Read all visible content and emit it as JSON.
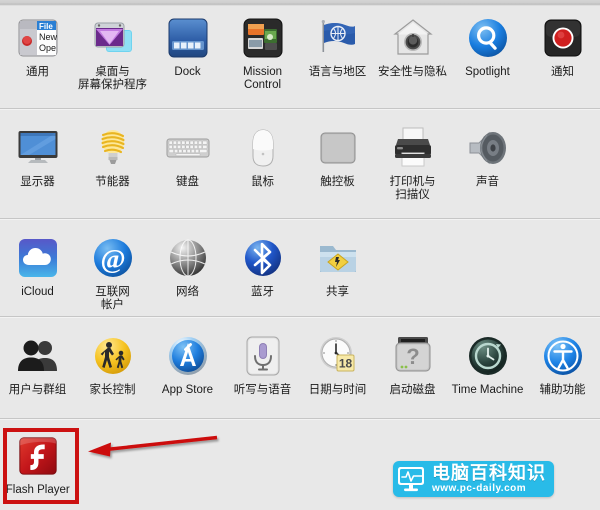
{
  "window": {
    "title": "System Preferences",
    "background_color": "#e8e8e8",
    "accent_color": "#cc1111"
  },
  "groups": [
    {
      "name": "personal",
      "items": [
        {
          "label": "通用",
          "icon": "general-icon"
        },
        {
          "label": "桌面与\n屏幕保护程序",
          "icon": "desktop-screensaver-icon"
        },
        {
          "label": "Dock",
          "icon": "dock-icon"
        },
        {
          "label": "Mission\nControl",
          "icon": "mission-control-icon"
        },
        {
          "label": "语言与地区",
          "icon": "language-region-icon"
        },
        {
          "label": "安全性与隐私",
          "icon": "security-privacy-icon"
        },
        {
          "label": "Spotlight",
          "icon": "spotlight-icon"
        },
        {
          "label": "通知",
          "icon": "notifications-icon"
        }
      ]
    },
    {
      "name": "hardware",
      "items": [
        {
          "label": "显示器",
          "icon": "displays-icon"
        },
        {
          "label": "节能器",
          "icon": "energy-saver-icon"
        },
        {
          "label": "键盘",
          "icon": "keyboard-icon"
        },
        {
          "label": "鼠标",
          "icon": "mouse-icon"
        },
        {
          "label": "触控板",
          "icon": "trackpad-icon"
        },
        {
          "label": "打印机与\n扫描仪",
          "icon": "printers-scanners-icon"
        },
        {
          "label": "声音",
          "icon": "sound-icon"
        }
      ]
    },
    {
      "name": "internet-wireless",
      "items": [
        {
          "label": "iCloud",
          "icon": "icloud-icon"
        },
        {
          "label": "互联网\n帐户",
          "icon": "internet-accounts-icon"
        },
        {
          "label": "网络",
          "icon": "network-icon"
        },
        {
          "label": "蓝牙",
          "icon": "bluetooth-icon"
        },
        {
          "label": "共享",
          "icon": "sharing-icon"
        }
      ]
    },
    {
      "name": "system",
      "items": [
        {
          "label": "用户与群组",
          "icon": "users-groups-icon"
        },
        {
          "label": "家长控制",
          "icon": "parental-controls-icon"
        },
        {
          "label": "App Store",
          "icon": "app-store-icon"
        },
        {
          "label": "听写与语音",
          "icon": "dictation-speech-icon"
        },
        {
          "label": "日期与时间",
          "icon": "date-time-icon"
        },
        {
          "label": "启动磁盘",
          "icon": "startup-disk-icon"
        },
        {
          "label": "Time Machine",
          "icon": "time-machine-icon"
        },
        {
          "label": "辅助功能",
          "icon": "accessibility-icon"
        }
      ]
    },
    {
      "name": "other",
      "items": [
        {
          "label": "Flash Player",
          "icon": "flash-player-icon"
        }
      ]
    }
  ],
  "annotation": {
    "highlight_target": "Flash Player",
    "arrow_color": "#cc1111",
    "box_color": "#cc1111"
  },
  "watermark": {
    "site_name": "电脑百科知识",
    "url": "www.pc-daily.com",
    "brand_color": "#29bbe8"
  }
}
